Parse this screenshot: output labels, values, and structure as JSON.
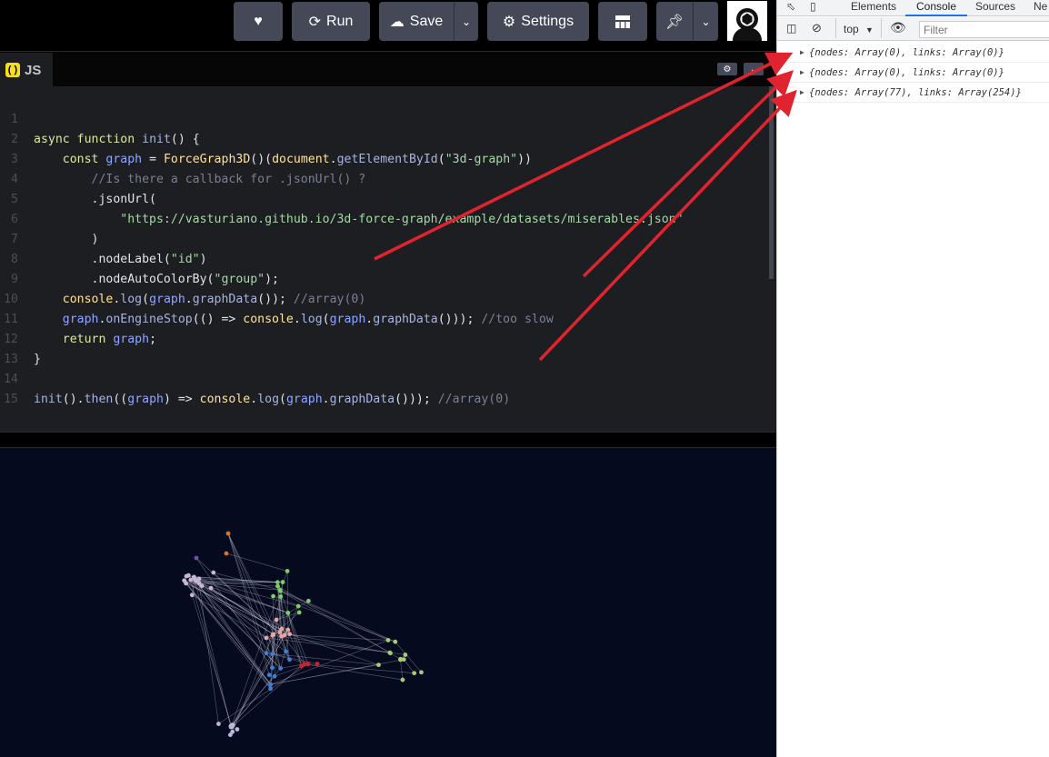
{
  "toolbar": {
    "like_icon": "heart-icon",
    "run_label": "Run",
    "save_label": "Save",
    "settings_label": "Settings",
    "layout_icon": "layout-icon",
    "pin_icon": "pin-icon"
  },
  "editor": {
    "tab_label": "JS",
    "lines": [
      {
        "n": "1"
      },
      {
        "n": "2"
      },
      {
        "n": "3"
      },
      {
        "n": "4"
      },
      {
        "n": "5"
      },
      {
        "n": "6"
      },
      {
        "n": "7"
      },
      {
        "n": "8"
      },
      {
        "n": "9"
      },
      {
        "n": "10"
      },
      {
        "n": "11"
      },
      {
        "n": "12"
      },
      {
        "n": "13"
      },
      {
        "n": "14"
      },
      {
        "n": "15"
      }
    ]
  },
  "devtools": {
    "tabs": [
      "Elements",
      "Console",
      "Sources",
      "Ne"
    ],
    "active_tab": "Console",
    "context": "top",
    "filter_placeholder": "Filter",
    "logs": [
      "{nodes: Array(0), links: Array(0)}",
      "{nodes: Array(0), links: Array(0)}",
      "{nodes: Array(77), links: Array(254)}"
    ],
    "prompt": "›"
  },
  "colors": {
    "annotation_arrow": "#e0232e",
    "editor_bg": "#1d1e22",
    "preview_bg": "#050a1e"
  }
}
